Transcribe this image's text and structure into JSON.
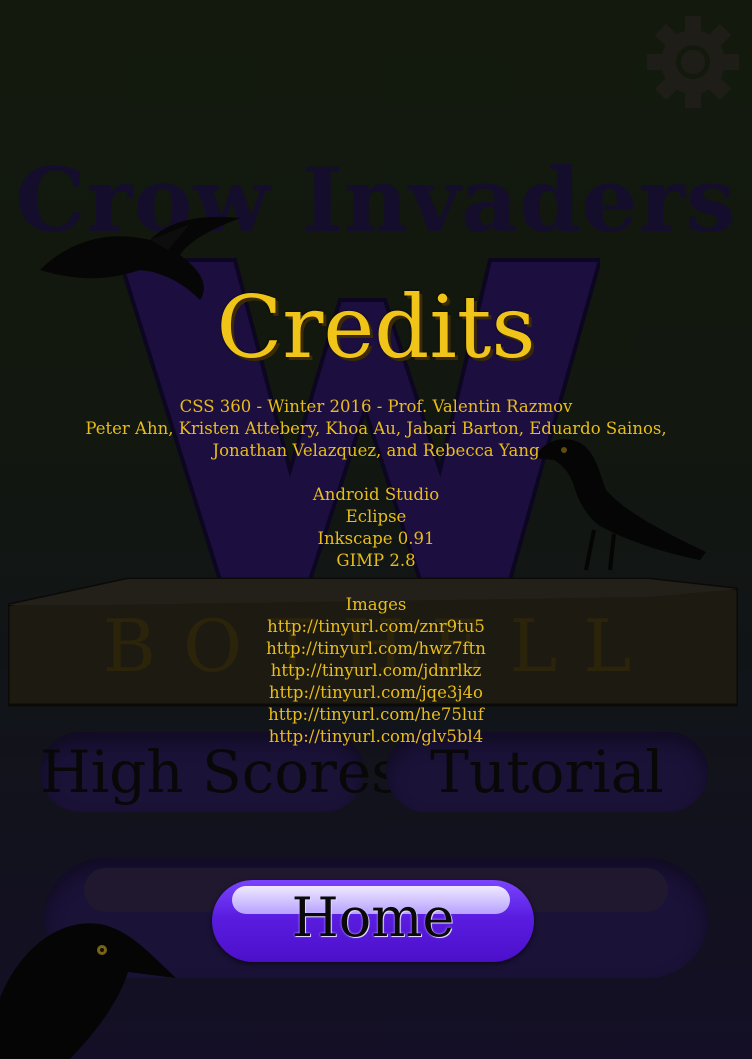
{
  "background": {
    "title": "Crow Invaders",
    "banner_text": "BOTHELL",
    "buttons": {
      "high_scores": "High Scores",
      "tutorial": "Tutorial"
    }
  },
  "credits": {
    "heading": "Credits",
    "course": "CSS 360 - Winter 2016 - Prof. Valentin Razmov",
    "team_line_1": "Peter Ahn, Kristen Attebery, Khoa Au, Jabari Barton, Eduardo Sainos,",
    "team_line_2": "Jonathan Velazquez, and Rebecca Yang",
    "tools": [
      "Android Studio",
      "Eclipse",
      "Inkscape 0.91",
      "GIMP 2.8"
    ],
    "images_heading": "Images",
    "image_links": [
      "http://tinyurl.com/znr9tu5",
      "http://tinyurl.com/hwz7ftn",
      "http://tinyurl.com/jdnrlkz",
      "http://tinyurl.com/jqe3j4o",
      "http://tinyurl.com/he75luf",
      "http://tinyurl.com/glv5bl4"
    ]
  },
  "home_button": {
    "label": "Home"
  },
  "icons": {
    "settings": "gear-icon"
  },
  "colors": {
    "gold_text": "#e8bd1b",
    "home_button": "#5a1de0",
    "background_purple": "#140d2c"
  }
}
